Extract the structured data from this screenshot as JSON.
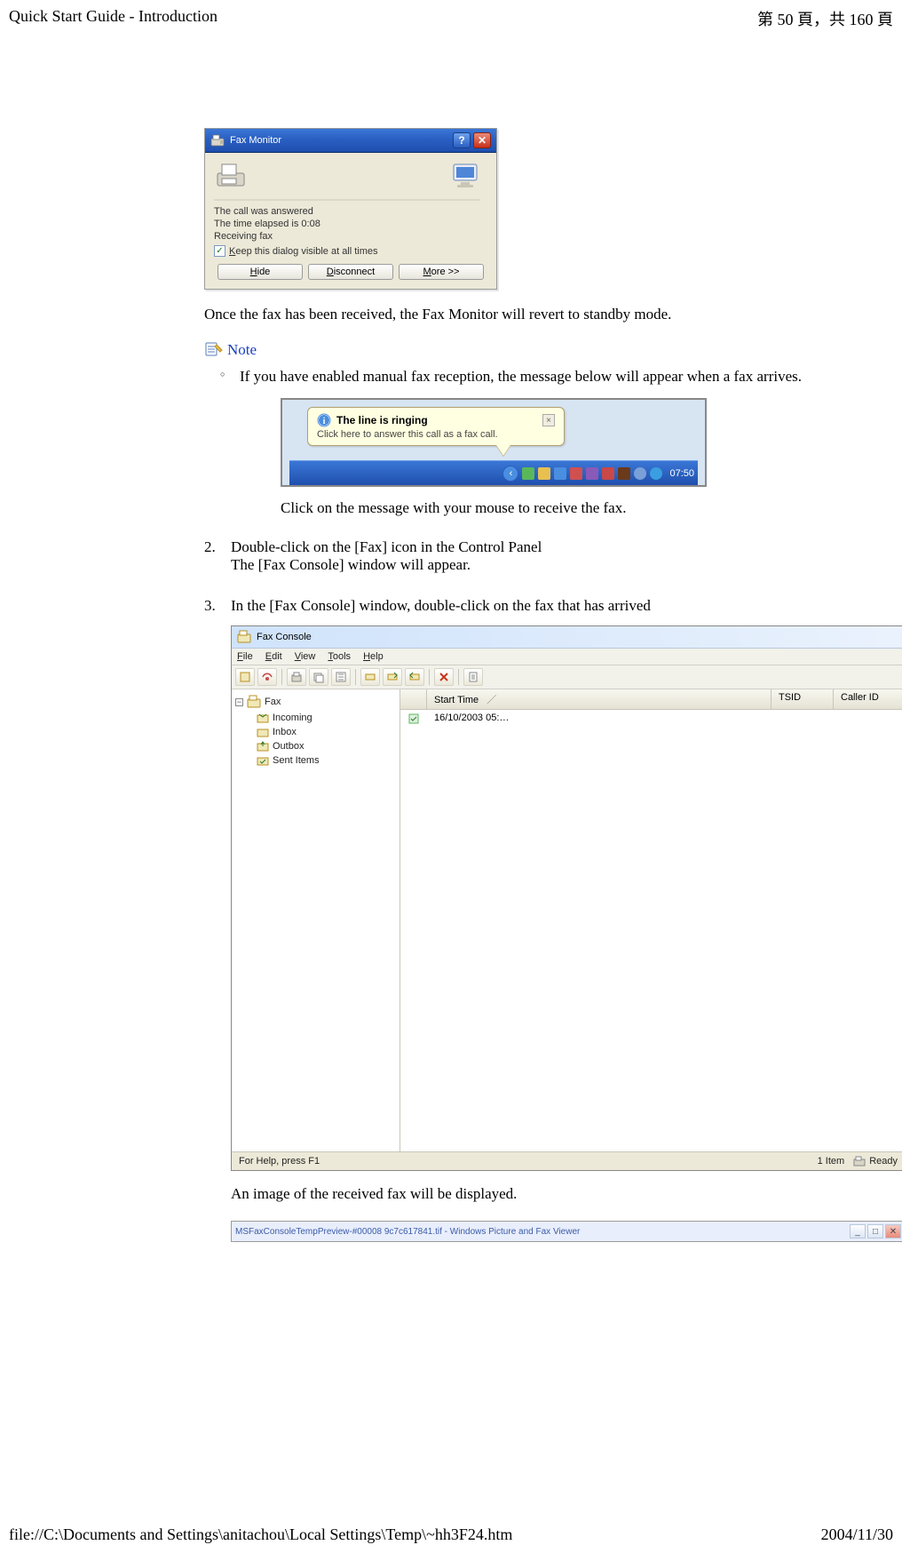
{
  "header": {
    "title": "Quick Start Guide - Introduction",
    "page_indicator": "第 50 頁，共 160 頁"
  },
  "fax_monitor": {
    "title": "Fax Monitor",
    "status1": "The call was answered",
    "status2": "The time elapsed is 0:08",
    "status3": "Receiving fax",
    "keep_visible_prefix": "K",
    "keep_visible_rest": "eep this dialog visible at all times",
    "btn_hide_u": "H",
    "btn_hide_rest": "ide",
    "btn_disc_u": "D",
    "btn_disc_rest": "isconnect",
    "btn_more_u": "M",
    "btn_more_rest": "ore >>",
    "help_glyph": "?",
    "close_glyph": "✕"
  },
  "text": {
    "after_monitor": "Once the fax has been received, the Fax Monitor will revert to standby mode.",
    "note_label": "Note",
    "note_item": "If you have enabled manual fax reception, the message below will appear when a fax arrives.",
    "click_msg": "Click on the message with your mouse to receive the fax.",
    "step2_a": "Double-click on the [Fax] icon in the Control Panel",
    "step2_b": "The [Fax Console] window will appear.",
    "step3": "In the [Fax Console] window, double-click on the fax that has arrived",
    "after_console": "An image of the received fax will be displayed."
  },
  "nums": {
    "two": "2.",
    "three": "3."
  },
  "balloon": {
    "title": "The line is ringing",
    "body": "Click here to answer this call as a fax call.",
    "close": "×",
    "time": "07:50"
  },
  "fax_console": {
    "title": "Fax Console",
    "menu": {
      "file": "File",
      "edit": "Edit",
      "view": "View",
      "tools": "Tools",
      "help": "Help"
    },
    "tree": {
      "root": "Fax",
      "incoming": "Incoming",
      "inbox": "Inbox",
      "outbox": "Outbox",
      "sent": "Sent Items"
    },
    "columns": {
      "blank": " ",
      "start": "Start Time",
      "sort": "／",
      "tsid": "TSID",
      "caller": "Caller ID"
    },
    "row": {
      "start": "16/10/2003 05:…"
    },
    "status_left": "For Help, press F1",
    "status_items": "1 Item",
    "status_ready": "Ready"
  },
  "viewer": {
    "title": "MSFaxConsoleTempPreview-#00008 9c7c617841.tif - Windows Picture and Fax Viewer",
    "min": "_",
    "max": "□",
    "close": "✕"
  },
  "footer": {
    "path": "file://C:\\Documents and Settings\\anitachou\\Local Settings\\Temp\\~hh3F24.htm",
    "date": "2004/11/30"
  }
}
